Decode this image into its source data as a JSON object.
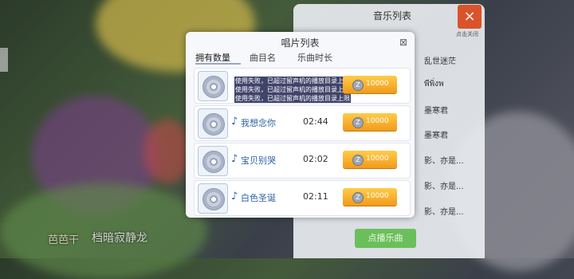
{
  "music_panel": {
    "title": "音乐列表",
    "close_label": "×",
    "close_caption": "点击关闭",
    "items": [
      "乱世迷茫",
      "พีพิ่งพ",
      "墨寒君",
      "墨寒君",
      "影、亦是...",
      "影、亦是...",
      "影、亦是..."
    ],
    "request_button": "点播乐曲"
  },
  "dialog": {
    "title": "唱片列表",
    "close_icon": "⊠",
    "tabs": [
      "拥有数量",
      "曲目名",
      "乐曲时长"
    ],
    "toasts": [
      "使用失败，已超过留声机的播放目录上限",
      "使用失败，已超过留声机的播放目录上限",
      "使用失败，已超过留声机的播放目录上限"
    ],
    "rows": [
      {
        "song": "",
        "duration": "",
        "price": "10000"
      },
      {
        "song": "我想念你",
        "duration": "02:44",
        "price": "10000"
      },
      {
        "song": "宝贝别哭",
        "duration": "02:02",
        "price": "10000"
      },
      {
        "song": "白色圣诞",
        "duration": "02:11",
        "price": "10000"
      }
    ]
  },
  "background_text": {
    "line1": "芭芭干",
    "line2": "档暗寂静龙"
  },
  "colors": {
    "accent": "#f29a1a",
    "song_text": "#2c5fa8",
    "close_red": "#d9532b"
  }
}
